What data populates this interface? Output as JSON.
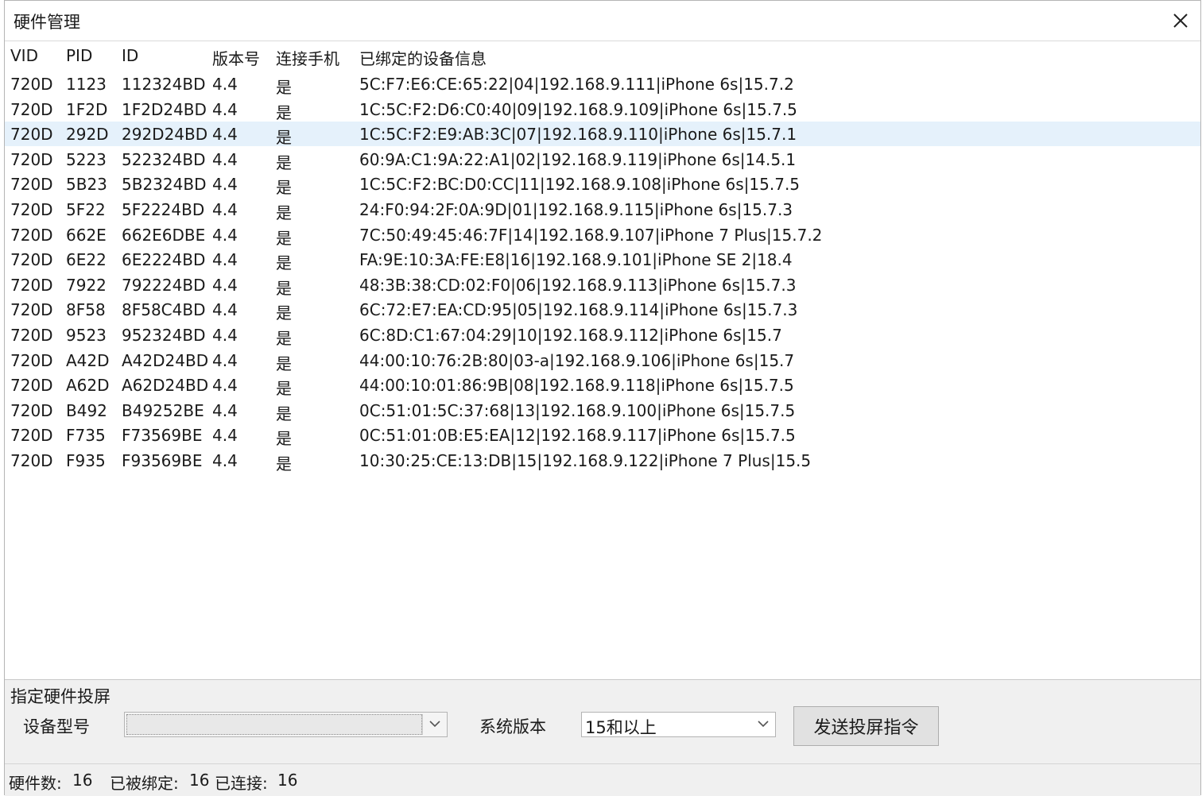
{
  "window": {
    "title": "硬件管理"
  },
  "list": {
    "headers": [
      "VID",
      "PID",
      "ID",
      "版本号",
      "连接手机",
      "已绑定的设备信息"
    ],
    "selected_index": 2,
    "rows": [
      [
        "720D",
        "1123",
        "112324BD",
        "4.4",
        "是",
        "5C:F7:E6:CE:65:22|04|192.168.9.111|iPhone 6s|15.7.2"
      ],
      [
        "720D",
        "1F2D",
        "1F2D24BD",
        "4.4",
        "是",
        "1C:5C:F2:D6:C0:40|09|192.168.9.109|iPhone 6s|15.7.5"
      ],
      [
        "720D",
        "292D",
        "292D24BD",
        "4.4",
        "是",
        "1C:5C:F2:E9:AB:3C|07|192.168.9.110|iPhone 6s|15.7.1"
      ],
      [
        "720D",
        "5223",
        "522324BD",
        "4.4",
        "是",
        "60:9A:C1:9A:22:A1|02|192.168.9.119|iPhone 6s|14.5.1"
      ],
      [
        "720D",
        "5B23",
        "5B2324BD",
        "4.4",
        "是",
        "1C:5C:F2:BC:D0:CC|11|192.168.9.108|iPhone 6s|15.7.5"
      ],
      [
        "720D",
        "5F22",
        "5F2224BD",
        "4.4",
        "是",
        "24:F0:94:2F:0A:9D|01|192.168.9.115|iPhone 6s|15.7.3"
      ],
      [
        "720D",
        "662E",
        "662E6DBE",
        "4.4",
        "是",
        "7C:50:49:45:46:7F|14|192.168.9.107|iPhone 7 Plus|15.7.2"
      ],
      [
        "720D",
        "6E22",
        "6E2224BD",
        "4.4",
        "是",
        "FA:9E:10:3A:FE:E8|16|192.168.9.101|iPhone SE 2|18.4"
      ],
      [
        "720D",
        "7922",
        "792224BD",
        "4.4",
        "是",
        "48:3B:38:CD:02:F0|06|192.168.9.113|iPhone 6s|15.7.3"
      ],
      [
        "720D",
        "8F58",
        "8F58C4BD",
        "4.4",
        "是",
        "6C:72:E7:EA:CD:95|05|192.168.9.114|iPhone 6s|15.7.3"
      ],
      [
        "720D",
        "9523",
        "952324BD",
        "4.4",
        "是",
        "6C:8D:C1:67:04:29|10|192.168.9.112|iPhone 6s|15.7"
      ],
      [
        "720D",
        "A42D",
        "A42D24BD",
        "4.4",
        "是",
        "44:00:10:76:2B:80|03-a|192.168.9.106|iPhone 6s|15.7"
      ],
      [
        "720D",
        "A62D",
        "A62D24BD",
        "4.4",
        "是",
        "44:00:10:01:86:9B|08|192.168.9.118|iPhone 6s|15.7.5"
      ],
      [
        "720D",
        "B492",
        "B49252BE",
        "4.4",
        "是",
        "0C:51:01:5C:37:68|13|192.168.9.100|iPhone 6s|15.7.5"
      ],
      [
        "720D",
        "F735",
        "F73569BE",
        "4.4",
        "是",
        "0C:51:01:0B:E5:EA|12|192.168.9.117|iPhone 6s|15.7.5"
      ],
      [
        "720D",
        "F935",
        "F93569BE",
        "4.4",
        "是",
        "10:30:25:CE:13:DB|15|192.168.9.122|iPhone 7 Plus|15.5"
      ]
    ]
  },
  "panel": {
    "title": "指定硬件投屏",
    "model_label": "设备型号",
    "model_value": "",
    "version_label": "系统版本",
    "version_value": "15和以上",
    "send_button": "发送投屏指令"
  },
  "status": {
    "count_label": "硬件数:",
    "count_value": "16",
    "bound_label": "已被绑定:",
    "bound_value": "16",
    "connected_label": "已连接:",
    "connected_value": "16"
  },
  "colors": {
    "selected_row": "#e5f1fb",
    "panel_bg": "#f0f0f0",
    "button_bg": "#e1e1e1"
  },
  "icons": {
    "close": "close-icon",
    "dropdown": "chevron-down-icon"
  }
}
